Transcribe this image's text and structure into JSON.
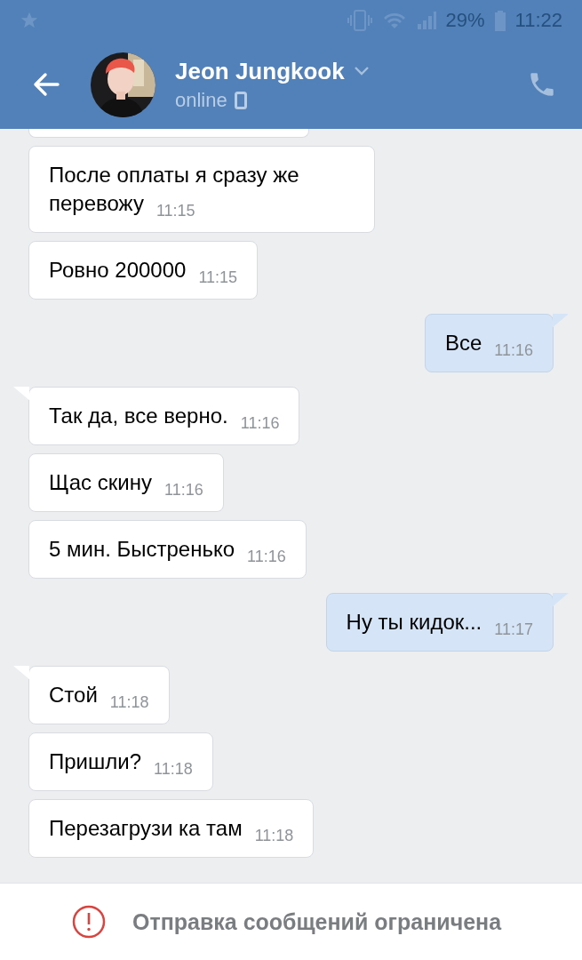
{
  "status_bar": {
    "battery": "29%",
    "time": "11:22"
  },
  "header": {
    "name": "Jeon Jungkook",
    "status": "online"
  },
  "messages": [
    {
      "kind": "in",
      "tail": false,
      "text": "После оплаты я сразу же перевожу",
      "time": "11:15"
    },
    {
      "kind": "in",
      "tail": false,
      "text": "Ровно 200000",
      "time": "11:15"
    },
    {
      "kind": "out",
      "tail": true,
      "text": "Все",
      "time": "11:16"
    },
    {
      "kind": "in",
      "tail": true,
      "text": "Так да, все верно.",
      "time": "11:16"
    },
    {
      "kind": "in",
      "tail": false,
      "text": "Щас скину",
      "time": "11:16"
    },
    {
      "kind": "in",
      "tail": false,
      "text": "5 мин. Быстренько",
      "time": "11:16"
    },
    {
      "kind": "out",
      "tail": true,
      "text": "Ну ты кидок...",
      "time": "11:17"
    },
    {
      "kind": "in",
      "tail": true,
      "text": "Стой",
      "time": "11:18"
    },
    {
      "kind": "in",
      "tail": false,
      "text": "Пришли?",
      "time": "11:18"
    },
    {
      "kind": "in",
      "tail": false,
      "text": "Перезагрузи ка там",
      "time": "11:18"
    }
  ],
  "notice": {
    "text": "Отправка сообщений ограничена"
  }
}
